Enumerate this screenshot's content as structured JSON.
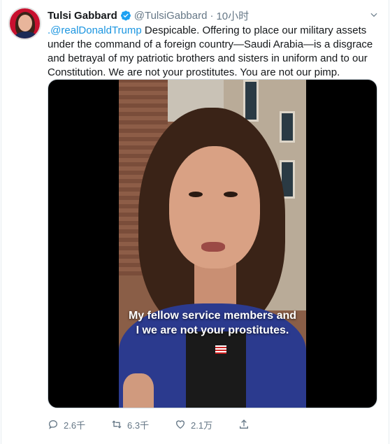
{
  "tweet": {
    "author": {
      "name": "Tulsi Gabbard",
      "handle": "@TulsiGabbard",
      "verified": true
    },
    "time": "10小时",
    "separator": "·",
    "text": {
      "mention": ".@realDonaldTrump",
      "body": " Despicable. Offering to place our military assets under the command of a foreign country—Saudi Arabia—is a disgrace and betrayal of my patriotic brothers and sisters in uniform and to our Constitution. We are not your prostitutes. You are not our pimp."
    },
    "media": {
      "type": "video",
      "caption_line1": "My fellow service members and",
      "caption_line2": "I we are not your prostitutes."
    },
    "actions": {
      "reply_count": "2.6千",
      "retweet_count": "6.3千",
      "like_count": "2.1万"
    }
  },
  "colors": {
    "link": "#1b95e0",
    "secondary_text": "#657786",
    "verified_badge": "#1da1f2"
  },
  "icons": [
    "verified-badge-icon",
    "caret-down-icon",
    "reply-icon",
    "retweet-icon",
    "like-icon",
    "share-icon"
  ]
}
